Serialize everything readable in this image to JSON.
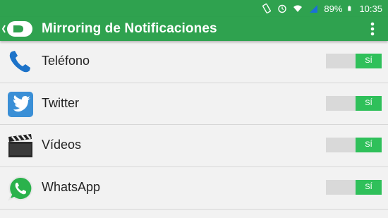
{
  "status_bar": {
    "battery": "89%",
    "time": "10:35"
  },
  "app_bar": {
    "title": "Mirroring de Notificaciones"
  },
  "apps": [
    {
      "label": "Teléfono",
      "icon": "phone-icon",
      "toggle": "SÍ"
    },
    {
      "label": "Twitter",
      "icon": "twitter-icon",
      "toggle": "SÍ"
    },
    {
      "label": "Vídeos",
      "icon": "clapperboard-icon",
      "toggle": "SÍ"
    },
    {
      "label": "WhatsApp",
      "icon": "whatsapp-icon",
      "toggle": "SÍ"
    }
  ],
  "colors": {
    "accent": "#2fa24f",
    "toggle_on": "#2fc05a"
  }
}
